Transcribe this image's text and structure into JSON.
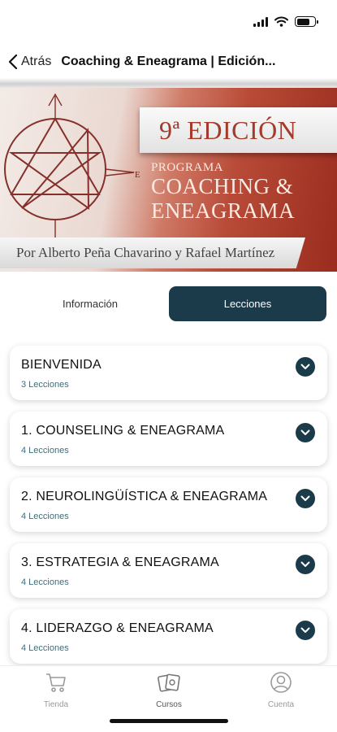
{
  "status_bar": {
    "icons": [
      "cellular-signal-icon",
      "wifi-icon",
      "battery-icon"
    ]
  },
  "nav": {
    "back_label": "Atrás",
    "title": "Coaching & Eneagrama | Edición..."
  },
  "banner": {
    "edition": "9ª EDICIÓN",
    "program": "PROGRAMA",
    "title_line1": "COACHING &",
    "title_line2": "ENEAGRAMA",
    "authors": "Por Alberto Peña Chavarino y Rafael Martínez",
    "compass_letter": "E"
  },
  "segment": {
    "info_label": "Información",
    "lessons_label": "Lecciones",
    "selected": "Lecciones"
  },
  "lessons": [
    {
      "title": "BIENVENIDA",
      "count": "3 Lecciones"
    },
    {
      "title": "1. COUNSELING & ENEAGRAMA",
      "count": "4 Lecciones"
    },
    {
      "title": "2. NEUROLINGÜÍSTICA & ENEAGRAMA",
      "count": "4 Lecciones"
    },
    {
      "title": "3. ESTRATEGIA & ENEAGRAMA",
      "count": "4 Lecciones"
    },
    {
      "title": "4. LIDERAZGO & ENEAGRAMA",
      "count": "4 Lecciones"
    }
  ],
  "tabs": [
    {
      "label": "Tienda",
      "icon": "cart-icon"
    },
    {
      "label": "Cursos",
      "icon": "cards-icon"
    },
    {
      "label": "Cuenta",
      "icon": "user-circle-icon"
    }
  ],
  "colors": {
    "accent": "#1b3a4a",
    "banner_red": "#a33a2b",
    "lesson_count": "#3f6d78"
  }
}
